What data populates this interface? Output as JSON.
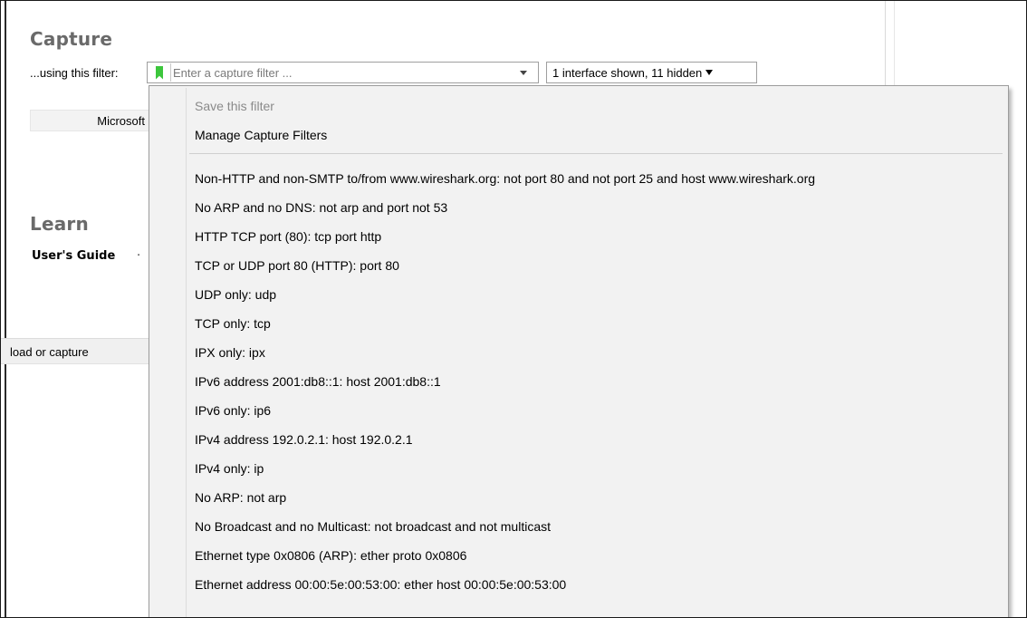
{
  "capture": {
    "heading": "Capture",
    "filter_label": "...using this filter:",
    "filter_placeholder": "Enter a capture filter ...",
    "interfaces_button": "1 interface shown, 11 hidden",
    "interface_name": "Microsoft"
  },
  "learn": {
    "heading": "Learn",
    "users_guide": "User's Guide",
    "separator": "·"
  },
  "status_bar": {
    "text": "load or capture"
  },
  "filter_menu": {
    "save_filter": "Save this filter",
    "manage_filters": "Manage Capture Filters",
    "filters": [
      "Non-HTTP and non-SMTP to/from www.wireshark.org: not port 80 and not port 25 and host www.wireshark.org",
      "No ARP and no DNS: not arp and port not 53",
      "HTTP TCP port (80): tcp port http",
      "TCP or UDP port 80 (HTTP): port 80",
      "UDP only: udp",
      "TCP only: tcp",
      "IPX only: ipx",
      "IPv6 address 2001:db8::1: host 2001:db8::1",
      "IPv6 only: ip6",
      "IPv4 address 192.0.2.1: host 192.0.2.1",
      "IPv4 only: ip",
      "No ARP: not arp",
      "No Broadcast and no Multicast: not broadcast and not multicast",
      "Ethernet type 0x0806 (ARP): ether proto 0x0806",
      "Ethernet address 00:00:5e:00:53:00: ether host 00:00:5e:00:53:00"
    ]
  },
  "icons": {
    "bookmark": "bookmark-icon",
    "dropdown": "chevron-down-icon"
  },
  "colors": {
    "bookmark_green": "#3cc63c",
    "heading_gray": "#6a6a6a",
    "menu_bg": "#f2f2f2"
  }
}
